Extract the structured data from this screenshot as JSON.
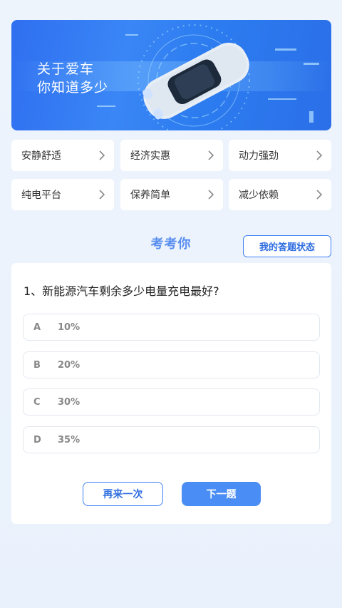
{
  "banner": {
    "line1": "关于爱车",
    "line2": "你知道多少"
  },
  "categories": [
    {
      "label": "安静舒适"
    },
    {
      "label": "经济实惠"
    },
    {
      "label": "动力强劲"
    },
    {
      "label": "纯电平台"
    },
    {
      "label": "保养简单"
    },
    {
      "label": "减少依赖"
    }
  ],
  "quiz": {
    "section_title": "考考你",
    "status_button": "我的答题状态",
    "question": "1、新能源汽车剩余多少电量充电最好?",
    "options": [
      {
        "letter": "A",
        "text": "10%"
      },
      {
        "letter": "B",
        "text": "20%"
      },
      {
        "letter": "C",
        "text": "30%"
      },
      {
        "letter": "D",
        "text": "35%"
      }
    ],
    "retry_button": "再来一次",
    "next_button": "下一题"
  },
  "colors": {
    "accent": "#4a8df4",
    "banner": "#2f6ff0",
    "background": "#eef4fc"
  }
}
